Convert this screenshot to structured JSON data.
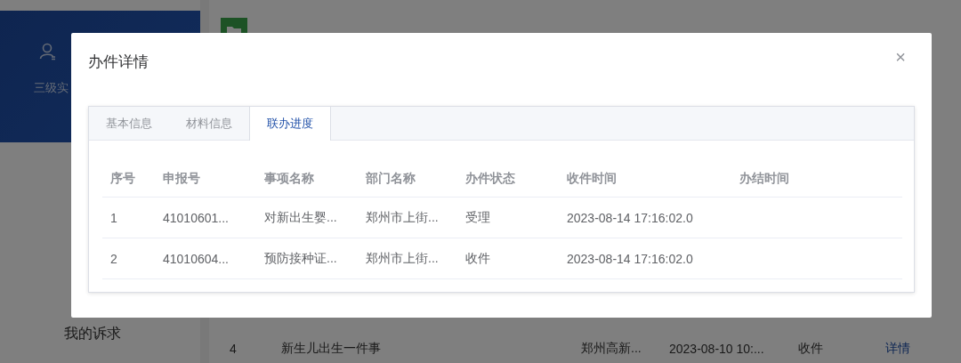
{
  "background": {
    "profile": {
      "text": "三级实"
    },
    "sidebar": {
      "items": [
        "我的诉求"
      ]
    },
    "list_row": {
      "cells": [
        "4",
        "新生儿出生一件事",
        "郑州高新...",
        "2023-08-10 10:...",
        "收件"
      ],
      "link": "详情"
    }
  },
  "dialog": {
    "title": "办件详情",
    "close": "×",
    "tabs": [
      {
        "label": "基本信息",
        "selected": false
      },
      {
        "label": "材料信息",
        "selected": false
      },
      {
        "label": "联办进度",
        "selected": true
      }
    ],
    "table": {
      "columns": [
        "序号",
        "申报号",
        "事项名称",
        "部门名称",
        "办件状态",
        "收件时间",
        "办结时间"
      ],
      "rows": [
        [
          "1",
          "41010601...",
          "对新出生婴...",
          "郑州市上街...",
          "受理",
          "2023-08-14 17:16:02.0",
          ""
        ],
        [
          "2",
          "41010604...",
          "预防接种证...",
          "郑州市上街...",
          "收件",
          "2023-08-14 17:16:02.0",
          ""
        ]
      ]
    }
  }
}
